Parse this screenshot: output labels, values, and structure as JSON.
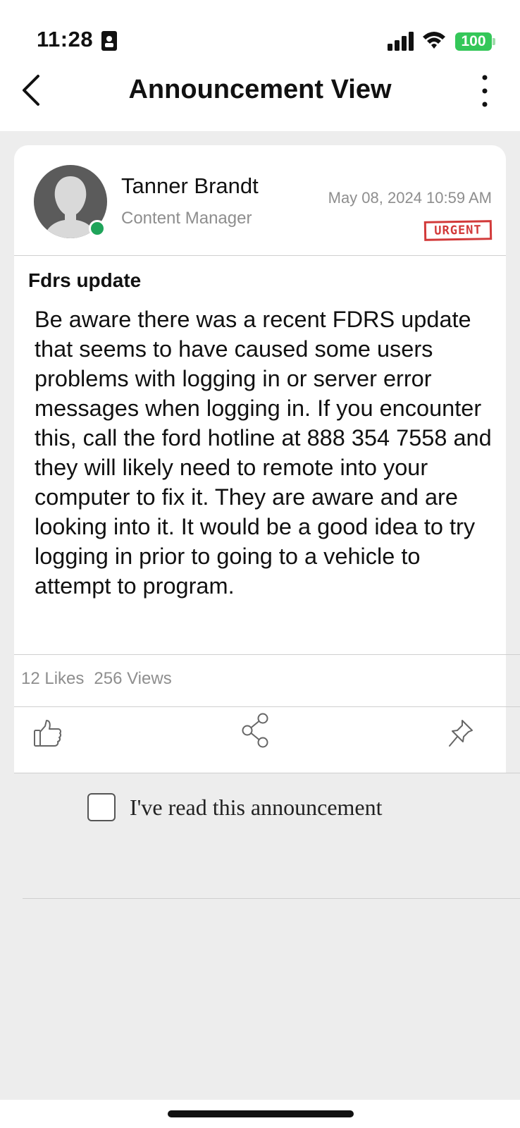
{
  "status_bar": {
    "time": "11:28",
    "battery": "100",
    "battery_color": "#34c759"
  },
  "nav": {
    "title": "Announcement View",
    "back_icon": "chevron-left-icon",
    "more_icon": "vertical-ellipsis-icon"
  },
  "post": {
    "author_name": "Tanner Brandt",
    "author_role": "Content Manager",
    "online_color": "#1fa45a",
    "date": "May 08, 2024 10:59 AM",
    "badge": "URGENT",
    "badge_color": "#d23a3a",
    "subject": "Fdrs update",
    "body": "Be aware there was a recent FDRS update that seems to have caused some users problems with logging in or server error messages when logging in. If you encounter this, call the ford hotline at 888 354 7558 and they will likely need to remote into your computer to fix it. They are aware and are looking into it. It would be a good idea to try logging in prior to going to a vehicle to attempt to program.",
    "likes": "12 Likes",
    "views": "256 Views"
  },
  "actions": {
    "like_icon": "thumbs-up-icon",
    "share_icon": "share-icon",
    "pin_icon": "pin-icon"
  },
  "acknowledge": {
    "label": "I've read this announcement",
    "checked": false
  }
}
